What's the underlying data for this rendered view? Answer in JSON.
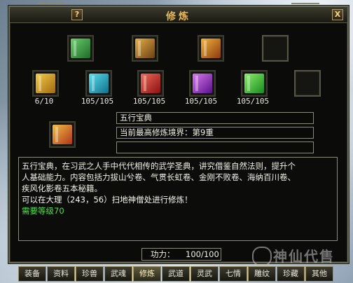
{
  "window": {
    "title": "修炼",
    "help_label": "?",
    "close_label": "X"
  },
  "top_slots": [
    {
      "icon": "book-icon",
      "color": "#3aa64a"
    },
    {
      "icon": "scroll-bundle-icon",
      "color": "#b5832c"
    },
    {
      "icon": "treasure-chest-icon",
      "color": "#d08a24"
    },
    {
      "icon": "empty-slot",
      "color": "#151512"
    }
  ],
  "books": [
    {
      "icon": "yellow-book-icon",
      "color": "#d8a522",
      "count": "6/10"
    },
    {
      "icon": "cyan-book-icon",
      "color": "#22a8c8",
      "count": "105/105"
    },
    {
      "icon": "red-book-icon",
      "color": "#c8322a",
      "count": "105/105"
    },
    {
      "icon": "purple-book-icon",
      "color": "#9a34b8",
      "count": "105/105"
    },
    {
      "icon": "green-book-icon",
      "color": "#3ab83a",
      "count": "105/105"
    },
    {
      "icon": "empty-slot",
      "color": "#151512",
      "count": ""
    }
  ],
  "selected": {
    "icon": "wuxing-book-icon",
    "name": "五行宝典",
    "realm": "当前最高修炼境界：第9重",
    "extra": ""
  },
  "description": {
    "line1": "五行宝典，在习武之人手中代代相传的武学圣典，讲究借鉴自然法则，提升个",
    "line2": "人基础能力。内容包括力拔山兮卷、气贯长虹卷、金刚不败卷、海纳百川卷、",
    "line3": "疾风化影卷五本秘籍。",
    "line4": "可以在大理（243，56）扫地神僧处进行修炼！",
    "requirement": "需要等级70"
  },
  "power": {
    "label": "功力：",
    "value": "100/100"
  },
  "tabs": [
    "装备",
    "资料",
    "珍兽",
    "武魂",
    "修炼",
    "武道",
    "灵武",
    "七情",
    "雕纹",
    "珍藏",
    "其他"
  ],
  "active_tab": "修炼",
  "watermark": "神仙代售"
}
